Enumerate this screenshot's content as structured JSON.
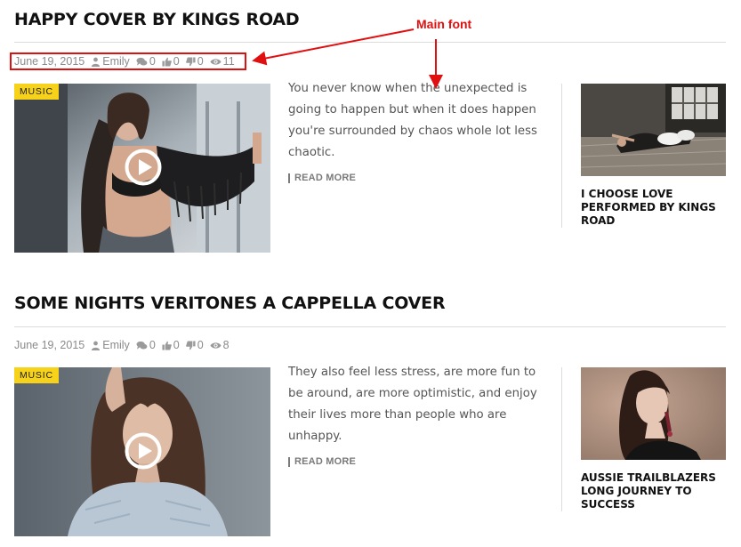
{
  "annotation": {
    "label": "Main font",
    "color": "#e01010"
  },
  "posts": [
    {
      "title": "HAPPY COVER BY KINGS ROAD",
      "meta": {
        "date": "June 19, 2015",
        "author": "Emily",
        "comments": "0",
        "likes": "0",
        "dislikes": "0",
        "views": "11"
      },
      "category": "MUSIC",
      "excerpt": "You never know when the unexpected is going to happen but when it does happen you're surrounded by chaos whole lot less chaotic.",
      "read_more": "READ MORE",
      "related": {
        "title": "I CHOOSE LOVE PERFORMED BY KINGS ROAD"
      }
    },
    {
      "title": "SOME NIGHTS VERITONES A CAPPELLA COVER",
      "meta": {
        "date": "June 19, 2015",
        "author": "Emily",
        "comments": "0",
        "likes": "0",
        "dislikes": "0",
        "views": "8"
      },
      "category": "MUSIC",
      "excerpt": "They also feel less stress, are more fun to be around, are more optimistic, and enjoy their lives more than people who are unhappy.",
      "read_more": "READ MORE",
      "related": {
        "title": "AUSSIE TRAILBLAZERS LONG JOURNEY TO SUCCESS"
      }
    }
  ],
  "colors": {
    "badge": "#f7d21a",
    "meta_text": "#8a8a8a",
    "title_text": "#111111"
  }
}
